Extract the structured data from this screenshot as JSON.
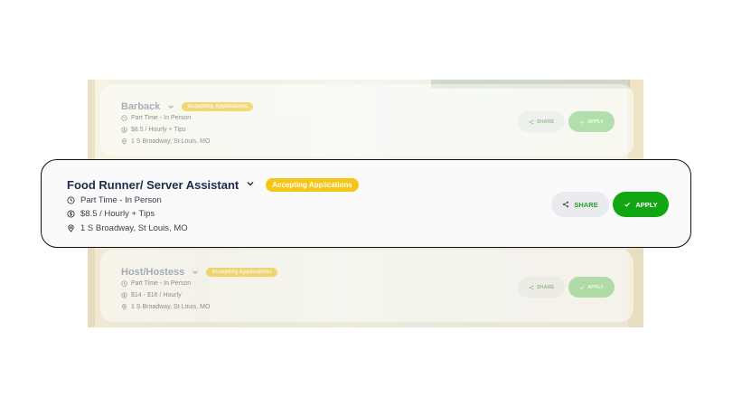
{
  "jobs": [
    {
      "title": "Barback",
      "status": "Accepting Applications",
      "schedule": "Part Time - In Person",
      "pay": "$8.5 / Hourly + Tips",
      "location": "1 S Broadway, St Louis, MO",
      "share_label": "SHARE",
      "apply_label": "APPLY"
    },
    {
      "title": "Food Runner/ Server Assistant",
      "status": "Accepting Applications",
      "schedule": "Part Time - In Person",
      "pay": "$8.5 / Hourly + Tips",
      "location": "1 S Broadway, St Louis, MO",
      "share_label": "SHARE",
      "apply_label": "APPLY"
    },
    {
      "title": "Host/Hostess",
      "status": "Accepting Applications",
      "schedule": "Part Time - In Person",
      "pay": "$14 - $16 / Hourly",
      "location": "1 S Broadway, St Louis, MO",
      "share_label": "SHARE",
      "apply_label": "APPLY"
    }
  ],
  "colors": {
    "badge": "#f5c518",
    "apply": "#12a612",
    "share_text": "#27a327",
    "title": "#1c2b4a"
  },
  "icons": {
    "expand": "chevron-down-icon",
    "schedule": "clock-icon",
    "pay": "dollar-icon",
    "location": "location-pin-icon",
    "share": "share-icon",
    "apply": "check-icon"
  }
}
